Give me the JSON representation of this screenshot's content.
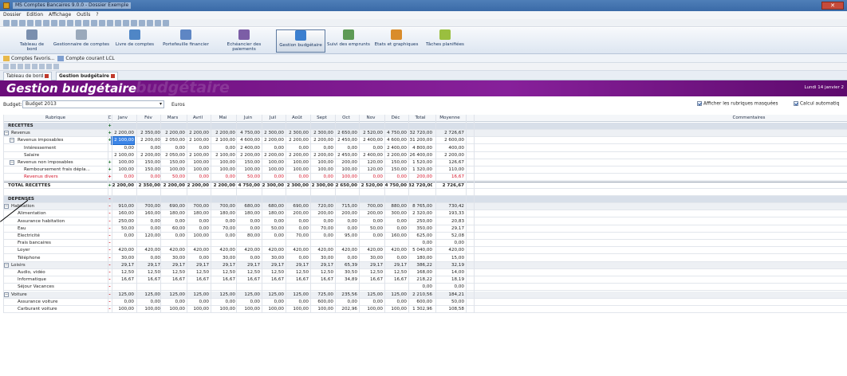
{
  "window": {
    "title": "MS Comptes Bancaires 9.0.0 - Dossier Exemple"
  },
  "menu": [
    "Dossier",
    "Edition",
    "Affichage",
    "Outils",
    "?"
  ],
  "ribbon": [
    {
      "label": "Tableau de bord",
      "color": "#7a8fae"
    },
    {
      "label": "Gestionnaire de comptes",
      "color": "#9aa9bb"
    },
    {
      "label": "Livre de comptes",
      "color": "#4f86c6"
    },
    {
      "label": "Portefeuille financier",
      "color": "#5e86c4"
    },
    {
      "label": "Echéancier des paiements",
      "color": "#7c5ea6"
    },
    {
      "label": "Gestion budgétaire",
      "color": "#3b7fcf",
      "active": true
    },
    {
      "label": "Suivi des emprunts",
      "color": "#5d9a56"
    },
    {
      "label": "Etats et graphiques",
      "color": "#d98c2b"
    },
    {
      "label": "Tâches planifiées",
      "color": "#9abf3f"
    }
  ],
  "favorites": {
    "label1": "Comptes favoris...",
    "label2": "Compte courant LCL"
  },
  "tabs": [
    {
      "label": "Tableau de bord"
    },
    {
      "label": "Gestion budgétaire"
    }
  ],
  "banner": {
    "title": "Gestion budgétaire",
    "ghost": "budgétaire",
    "date": "Lundi 14 janvier 2"
  },
  "budget": {
    "label": "Budget:",
    "value": "Budget 2013",
    "currency": "Euros",
    "opt1": "Afficher les rubriques masquées",
    "opt2": "Calcul automatiq"
  },
  "columns": [
    "Rubrique",
    "C",
    "Janv",
    "Fév",
    "Mars",
    "Avril",
    "Mai",
    "Juin",
    "Juil",
    "Août",
    "Sept",
    "Oct",
    "Nov",
    "Déc",
    "Total",
    "Moyenne",
    "Commentaires"
  ],
  "rows": [
    {
      "t": "sec",
      "name": "RECETTES",
      "c": "+",
      "v": []
    },
    {
      "t": "grp",
      "name": "Revenus",
      "c": "+",
      "exp": "-",
      "v": [
        "2 200,00",
        "2 350,00",
        "2 200,00",
        "2 200,00",
        "2 200,00",
        "4 750,00",
        "2 300,00",
        "2 300,00",
        "2 300,00",
        "2 650,00",
        "2 520,00",
        "4 750,00",
        "32 720,00",
        "2 726,67"
      ]
    },
    {
      "t": "sub",
      "name": "Revenus imposables",
      "c": "+",
      "exp": "-",
      "lvl": 1,
      "v": [
        "2 100,00",
        "2 200,00",
        "2 050,00",
        "2 100,00",
        "2 100,00",
        "4 600,00",
        "2 200,00",
        "2 200,00",
        "2 200,00",
        "2 450,00",
        "2 400,00",
        "4 600,00",
        "31 200,00",
        "2 600,00"
      ],
      "sel": 0
    },
    {
      "t": "item",
      "name": "Intéressement",
      "c": "",
      "lvl": 2,
      "v": [
        "0,00",
        "0,00",
        "0,00",
        "0,00",
        "0,00",
        "2 400,00",
        "0,00",
        "0,00",
        "0,00",
        "0,00",
        "0,00",
        "2 400,00",
        "4 800,00",
        "400,00"
      ]
    },
    {
      "t": "item",
      "name": "Salaire",
      "c": "",
      "lvl": 2,
      "v": [
        "2 100,00",
        "2 200,00",
        "2 050,00",
        "2 100,00",
        "2 100,00",
        "2 200,00",
        "2 200,00",
        "2 200,00",
        "2 200,00",
        "2 450,00",
        "2 400,00",
        "2 200,00",
        "26 400,00",
        "2 200,00"
      ]
    },
    {
      "t": "sub",
      "name": "Revenus non imposables",
      "c": "+",
      "exp": "-",
      "lvl": 1,
      "v": [
        "100,00",
        "150,00",
        "150,00",
        "100,00",
        "100,00",
        "150,00",
        "100,00",
        "100,00",
        "100,00",
        "200,00",
        "120,00",
        "150,00",
        "1 520,00",
        "126,67"
      ]
    },
    {
      "t": "item",
      "name": "Remboursement frais dépla...",
      "c": "+",
      "lvl": 2,
      "v": [
        "100,00",
        "150,00",
        "100,00",
        "100,00",
        "100,00",
        "100,00",
        "100,00",
        "100,00",
        "100,00",
        "100,00",
        "120,00",
        "150,00",
        "1 320,00",
        "110,00"
      ]
    },
    {
      "t": "red",
      "name": "Revenus divers",
      "c": "+",
      "lvl": 2,
      "v": [
        "0,00",
        "0,00",
        "50,00",
        "0,00",
        "0,00",
        "50,00",
        "0,00",
        "0,00",
        "0,00",
        "100,00",
        "0,00",
        "0,00",
        "200,00",
        "16,67"
      ]
    },
    {
      "t": "total",
      "name": "TOTAL RECETTES",
      "c": "+",
      "v": [
        "2 200,00",
        "2 350,00",
        "2 200,00",
        "2 200,00",
        "2 200,00",
        "4 750,00",
        "2 300,00",
        "2 300,00",
        "2 300,00",
        "2 650,00",
        "2 520,00",
        "4 750,00",
        "32 720,00",
        "2 726,67"
      ]
    },
    {
      "t": "blank",
      "name": "",
      "c": "",
      "v": []
    },
    {
      "t": "sec",
      "name": "DEPENSES",
      "c": "-",
      "v": []
    },
    {
      "t": "grp",
      "name": "Habitation",
      "c": "-",
      "exp": "-",
      "v": [
        "910,00",
        "700,00",
        "690,00",
        "700,00",
        "700,00",
        "680,00",
        "680,00",
        "690,00",
        "720,00",
        "715,00",
        "700,00",
        "880,00",
        "8 765,00",
        "730,42"
      ]
    },
    {
      "t": "item",
      "name": "Alimentation",
      "c": "-",
      "lvl": 1,
      "v": [
        "160,00",
        "160,00",
        "180,00",
        "180,00",
        "180,00",
        "180,00",
        "180,00",
        "200,00",
        "200,00",
        "200,00",
        "200,00",
        "300,00",
        "2 320,00",
        "193,33"
      ]
    },
    {
      "t": "item",
      "name": "Assurance habitation",
      "c": "-",
      "lvl": 1,
      "v": [
        "250,00",
        "0,00",
        "0,00",
        "0,00",
        "0,00",
        "0,00",
        "0,00",
        "0,00",
        "0,00",
        "0,00",
        "0,00",
        "0,00",
        "250,00",
        "20,83"
      ]
    },
    {
      "t": "item",
      "name": "Eau",
      "c": "-",
      "lvl": 1,
      "v": [
        "50,00",
        "0,00",
        "60,00",
        "0,00",
        "70,00",
        "0,00",
        "50,00",
        "0,00",
        "70,00",
        "0,00",
        "50,00",
        "0,00",
        "350,00",
        "29,17"
      ]
    },
    {
      "t": "item",
      "name": "Electricité",
      "c": "-",
      "lvl": 1,
      "v": [
        "0,00",
        "120,00",
        "0,00",
        "100,00",
        "0,00",
        "80,00",
        "0,00",
        "70,00",
        "0,00",
        "95,00",
        "0,00",
        "160,00",
        "625,00",
        "52,08"
      ]
    },
    {
      "t": "item",
      "name": "Frais bancaires",
      "c": "-",
      "lvl": 1,
      "v": [
        "",
        "",
        "",
        "",
        "",
        "",
        "",
        "",
        "",
        "",
        "",
        "",
        "0,00",
        "0,00"
      ]
    },
    {
      "t": "item",
      "name": "Loyer",
      "c": "-",
      "lvl": 1,
      "v": [
        "420,00",
        "420,00",
        "420,00",
        "420,00",
        "420,00",
        "420,00",
        "420,00",
        "420,00",
        "420,00",
        "420,00",
        "420,00",
        "420,00",
        "5 040,00",
        "420,00"
      ]
    },
    {
      "t": "item",
      "name": "Téléphone",
      "c": "-",
      "lvl": 1,
      "v": [
        "30,00",
        "0,00",
        "30,00",
        "0,00",
        "30,00",
        "0,00",
        "30,00",
        "0,00",
        "30,00",
        "0,00",
        "30,00",
        "0,00",
        "180,00",
        "15,00"
      ]
    },
    {
      "t": "grp",
      "name": "Loisirs",
      "c": "-",
      "exp": "-",
      "v": [
        "29,17",
        "29,17",
        "29,17",
        "29,17",
        "29,17",
        "29,17",
        "29,17",
        "29,17",
        "29,17",
        "65,39",
        "29,17",
        "29,17",
        "386,22",
        "32,19"
      ]
    },
    {
      "t": "item",
      "name": "Audio, vidéo",
      "c": "-",
      "lvl": 1,
      "v": [
        "12,50",
        "12,50",
        "12,50",
        "12,50",
        "12,50",
        "12,50",
        "12,50",
        "12,50",
        "12,50",
        "30,50",
        "12,50",
        "12,50",
        "168,00",
        "14,00"
      ]
    },
    {
      "t": "item",
      "name": "Informatique",
      "c": "-",
      "lvl": 1,
      "v": [
        "16,67",
        "16,67",
        "16,67",
        "16,67",
        "16,67",
        "16,67",
        "16,67",
        "16,67",
        "16,67",
        "34,89",
        "16,67",
        "16,67",
        "218,22",
        "18,19"
      ]
    },
    {
      "t": "item",
      "name": "Séjour Vacances",
      "c": "-",
      "lvl": 1,
      "v": [
        "",
        "",
        "",
        "",
        "",
        "",
        "",
        "",
        "",
        "",
        "",
        "",
        "0,00",
        "0,00"
      ]
    },
    {
      "t": "grp",
      "name": "Voiture",
      "c": "-",
      "exp": "-",
      "v": [
        "125,00",
        "125,00",
        "125,00",
        "125,00",
        "125,00",
        "125,00",
        "125,00",
        "125,00",
        "725,00",
        "235,56",
        "125,00",
        "125,00",
        "2 210,56",
        "184,21"
      ]
    },
    {
      "t": "item",
      "name": "Assurance voiture",
      "c": "-",
      "lvl": 1,
      "v": [
        "0,00",
        "0,00",
        "0,00",
        "0,00",
        "0,00",
        "0,00",
        "0,00",
        "0,00",
        "600,00",
        "0,00",
        "0,00",
        "0,00",
        "600,00",
        "50,00"
      ]
    },
    {
      "t": "item",
      "name": "Carburant voiture",
      "c": "-",
      "lvl": 1,
      "v": [
        "100,00",
        "100,00",
        "100,00",
        "100,00",
        "100,00",
        "100,00",
        "100,00",
        "100,00",
        "100,00",
        "202,96",
        "100,00",
        "100,00",
        "1 302,96",
        "108,58"
      ]
    }
  ]
}
